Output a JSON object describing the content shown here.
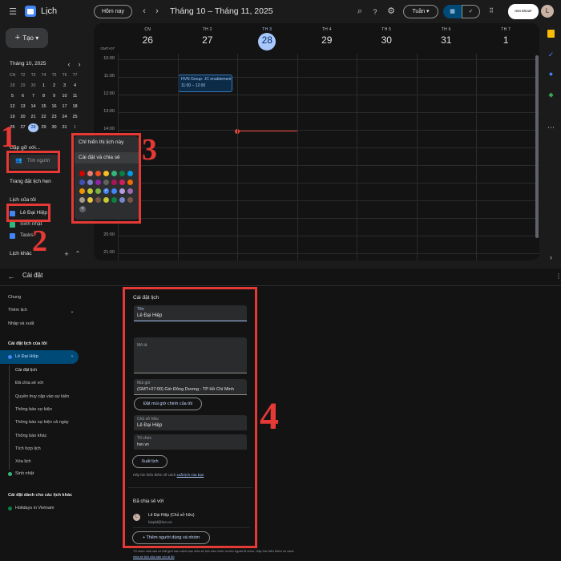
{
  "header": {
    "app_title": "Lịch",
    "today": "Hôm nay",
    "range": "Tháng 10 – Tháng 11, 2025",
    "view": "Tuần",
    "brand": "HVN GROUP",
    "avatar": "L"
  },
  "sidebar": {
    "create": "Tạo",
    "mini_month": "Tháng 10, 2025",
    "weekdays": [
      "CN",
      "T2",
      "T3",
      "T4",
      "T5",
      "T6",
      "T7"
    ],
    "weeks": [
      [
        "28",
        "29",
        "30",
        "1",
        "2",
        "3",
        "4"
      ],
      [
        "5",
        "6",
        "7",
        "8",
        "9",
        "10",
        "11"
      ],
      [
        "12",
        "13",
        "14",
        "15",
        "16",
        "17",
        "18"
      ],
      [
        "19",
        "20",
        "21",
        "22",
        "23",
        "24",
        "25"
      ],
      [
        "26",
        "27",
        "28",
        "29",
        "30",
        "31",
        "1"
      ]
    ],
    "meet_with": "Gặp gỡ với...",
    "search_people": "Tìm người",
    "booking": "Trang đặt lịch hẹn",
    "my_calendars": "Lịch của tôi",
    "cal1": "Lê Đại Hiệp",
    "cal2": "Sinh nhật",
    "cal3": "Tasks",
    "other": "Lịch khác"
  },
  "week": {
    "tz": "GMT+07",
    "days": [
      {
        "n": "CN",
        "d": "26"
      },
      {
        "n": "TH 2",
        "d": "27"
      },
      {
        "n": "TH 3",
        "d": "28"
      },
      {
        "n": "TH 4",
        "d": "29"
      },
      {
        "n": "TH 5",
        "d": "30"
      },
      {
        "n": "TH 6",
        "d": "31"
      },
      {
        "n": "TH 7",
        "d": "1"
      }
    ],
    "hours": [
      "10:00",
      "11:00",
      "12:00",
      "13:00",
      "14:00",
      "15:00",
      "16:00",
      "17:00",
      "18:00",
      "19:00",
      "20:00",
      "21:00"
    ],
    "event": {
      "title": "HVN Group- JC enablement",
      "time": "11:00 – 12:00"
    }
  },
  "popup": {
    "only": "Chỉ hiển thị lịch này",
    "settings": "Cài đặt và chia sẻ",
    "colors": [
      "#d50000",
      "#e67c73",
      "#f4511e",
      "#f6bf26",
      "#33b679",
      "#0b8043",
      "#039be5",
      "#3f51b5",
      "#7986cb",
      "#8e24aa",
      "#616161",
      "#ad1457",
      "#d81b60",
      "#ef6c00",
      "#f09300",
      "#c0ca33",
      "#7cb342",
      "#009688",
      "#4285f4",
      "#b39ddb",
      "#9e69af",
      "#a79b8e",
      "#e4c441",
      "#795548",
      "#c0ca33",
      "#0b8043",
      "#7986cb",
      "#795548"
    ]
  },
  "settings": {
    "title": "Cài đặt",
    "nav": [
      {
        "t": "Chung",
        "dot": ""
      },
      {
        "t": "Thêm lịch",
        "dot": ""
      },
      {
        "t": "Nhập và xuất",
        "dot": ""
      }
    ],
    "my_section": "Cài đặt lịch của tôi",
    "my_cal": "Lê Đại Hiệp",
    "sub": [
      "Cài đặt lịch",
      "Đã chia sẻ với",
      "Quyền truy cập vào sự kiện",
      "Thông báo sự kiện",
      "Thông báo sự kiện cả ngày",
      "Thông báo khác",
      "Tích hợp lịch",
      "Xóa lịch"
    ],
    "birthday": "Sinh nhật",
    "other_section": "Cài đặt dành cho các lịch khác",
    "holidays": "Holidays in Vietnam",
    "panel_title": "Cài đặt lịch",
    "name_label": "Tên",
    "name_value": "Lê Đại Hiệp",
    "desc_label": "Mô tả",
    "tz_label": "Múi giờ",
    "tz_value": "(GMT+07:00) Giờ Đông Dương - TP Hồ Chí Minh",
    "tz_button": "Đặt múi giờ chính của tôi",
    "owner_label": "Chủ sở hữu",
    "owner_value": "Lê Đại Hiệp",
    "org_label": "Tổ chức",
    "org_value": "hvn.vn",
    "export": "Xuất lịch",
    "learn": "Hãy tìm hiểu thêm về cách",
    "learn_link": "xuất lịch của bạn",
    "shared_title": "Đã chia sẻ với",
    "shared_name": "Lê Đại Hiệp (Chủ sở hữu)",
    "shared_email": "hiepld@hvn.vn",
    "add_people": "Thêm người dùng và nhóm",
    "foot1": "Tổ chức của bạn có thể giới hạn cách bạn chia sẻ lịch của mình ra bên ngoài tổ chức. Hãy tìm hiểu thêm về cách",
    "foot2": "chia sẻ lịch của bạn với ai đó"
  },
  "steps": [
    "1",
    "2",
    "3",
    "4"
  ]
}
